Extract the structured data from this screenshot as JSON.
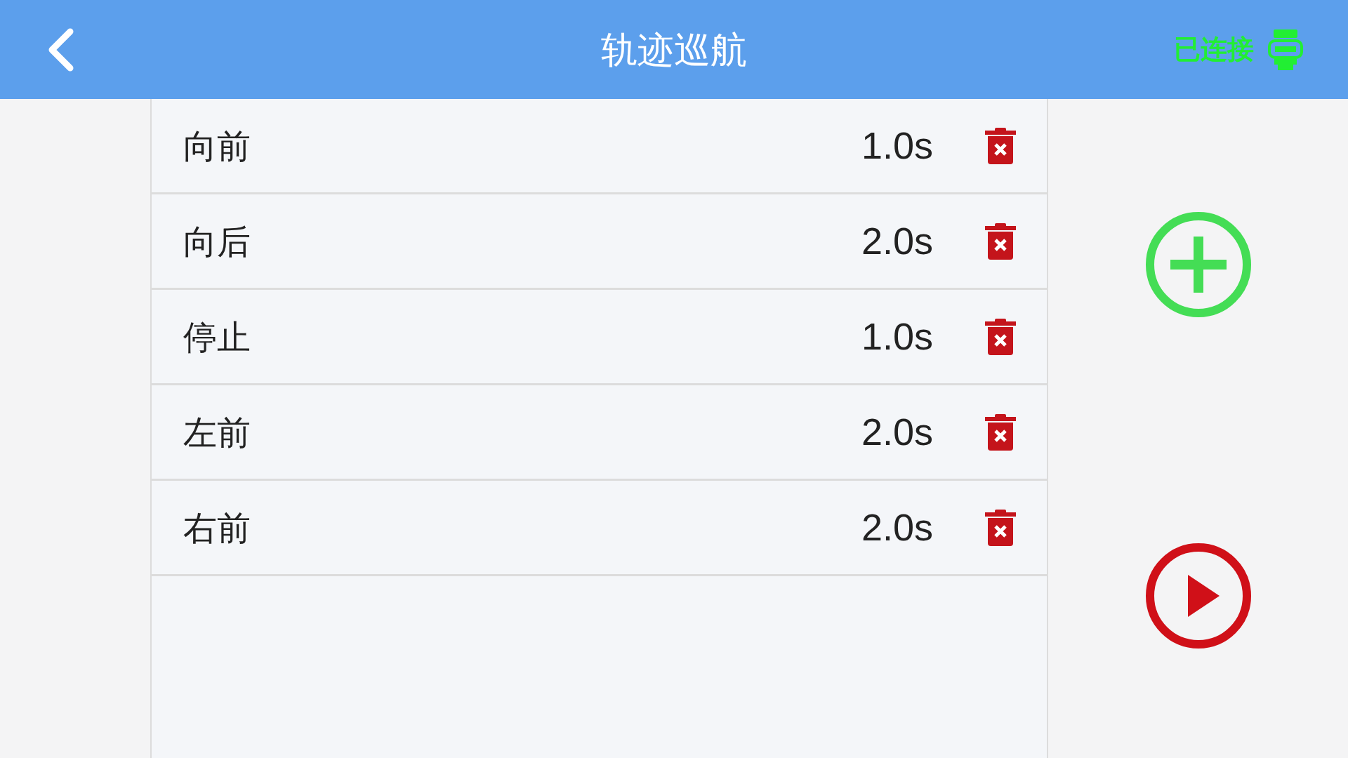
{
  "header": {
    "title": "轨迹巡航",
    "status": {
      "label": "已连接",
      "connected": true
    }
  },
  "steps": [
    {
      "action": "向前",
      "duration": "1.0s"
    },
    {
      "action": "向后",
      "duration": "2.0s"
    },
    {
      "action": "停止",
      "duration": "1.0s"
    },
    {
      "action": "左前",
      "duration": "2.0s"
    },
    {
      "action": "右前",
      "duration": "2.0s"
    }
  ]
}
